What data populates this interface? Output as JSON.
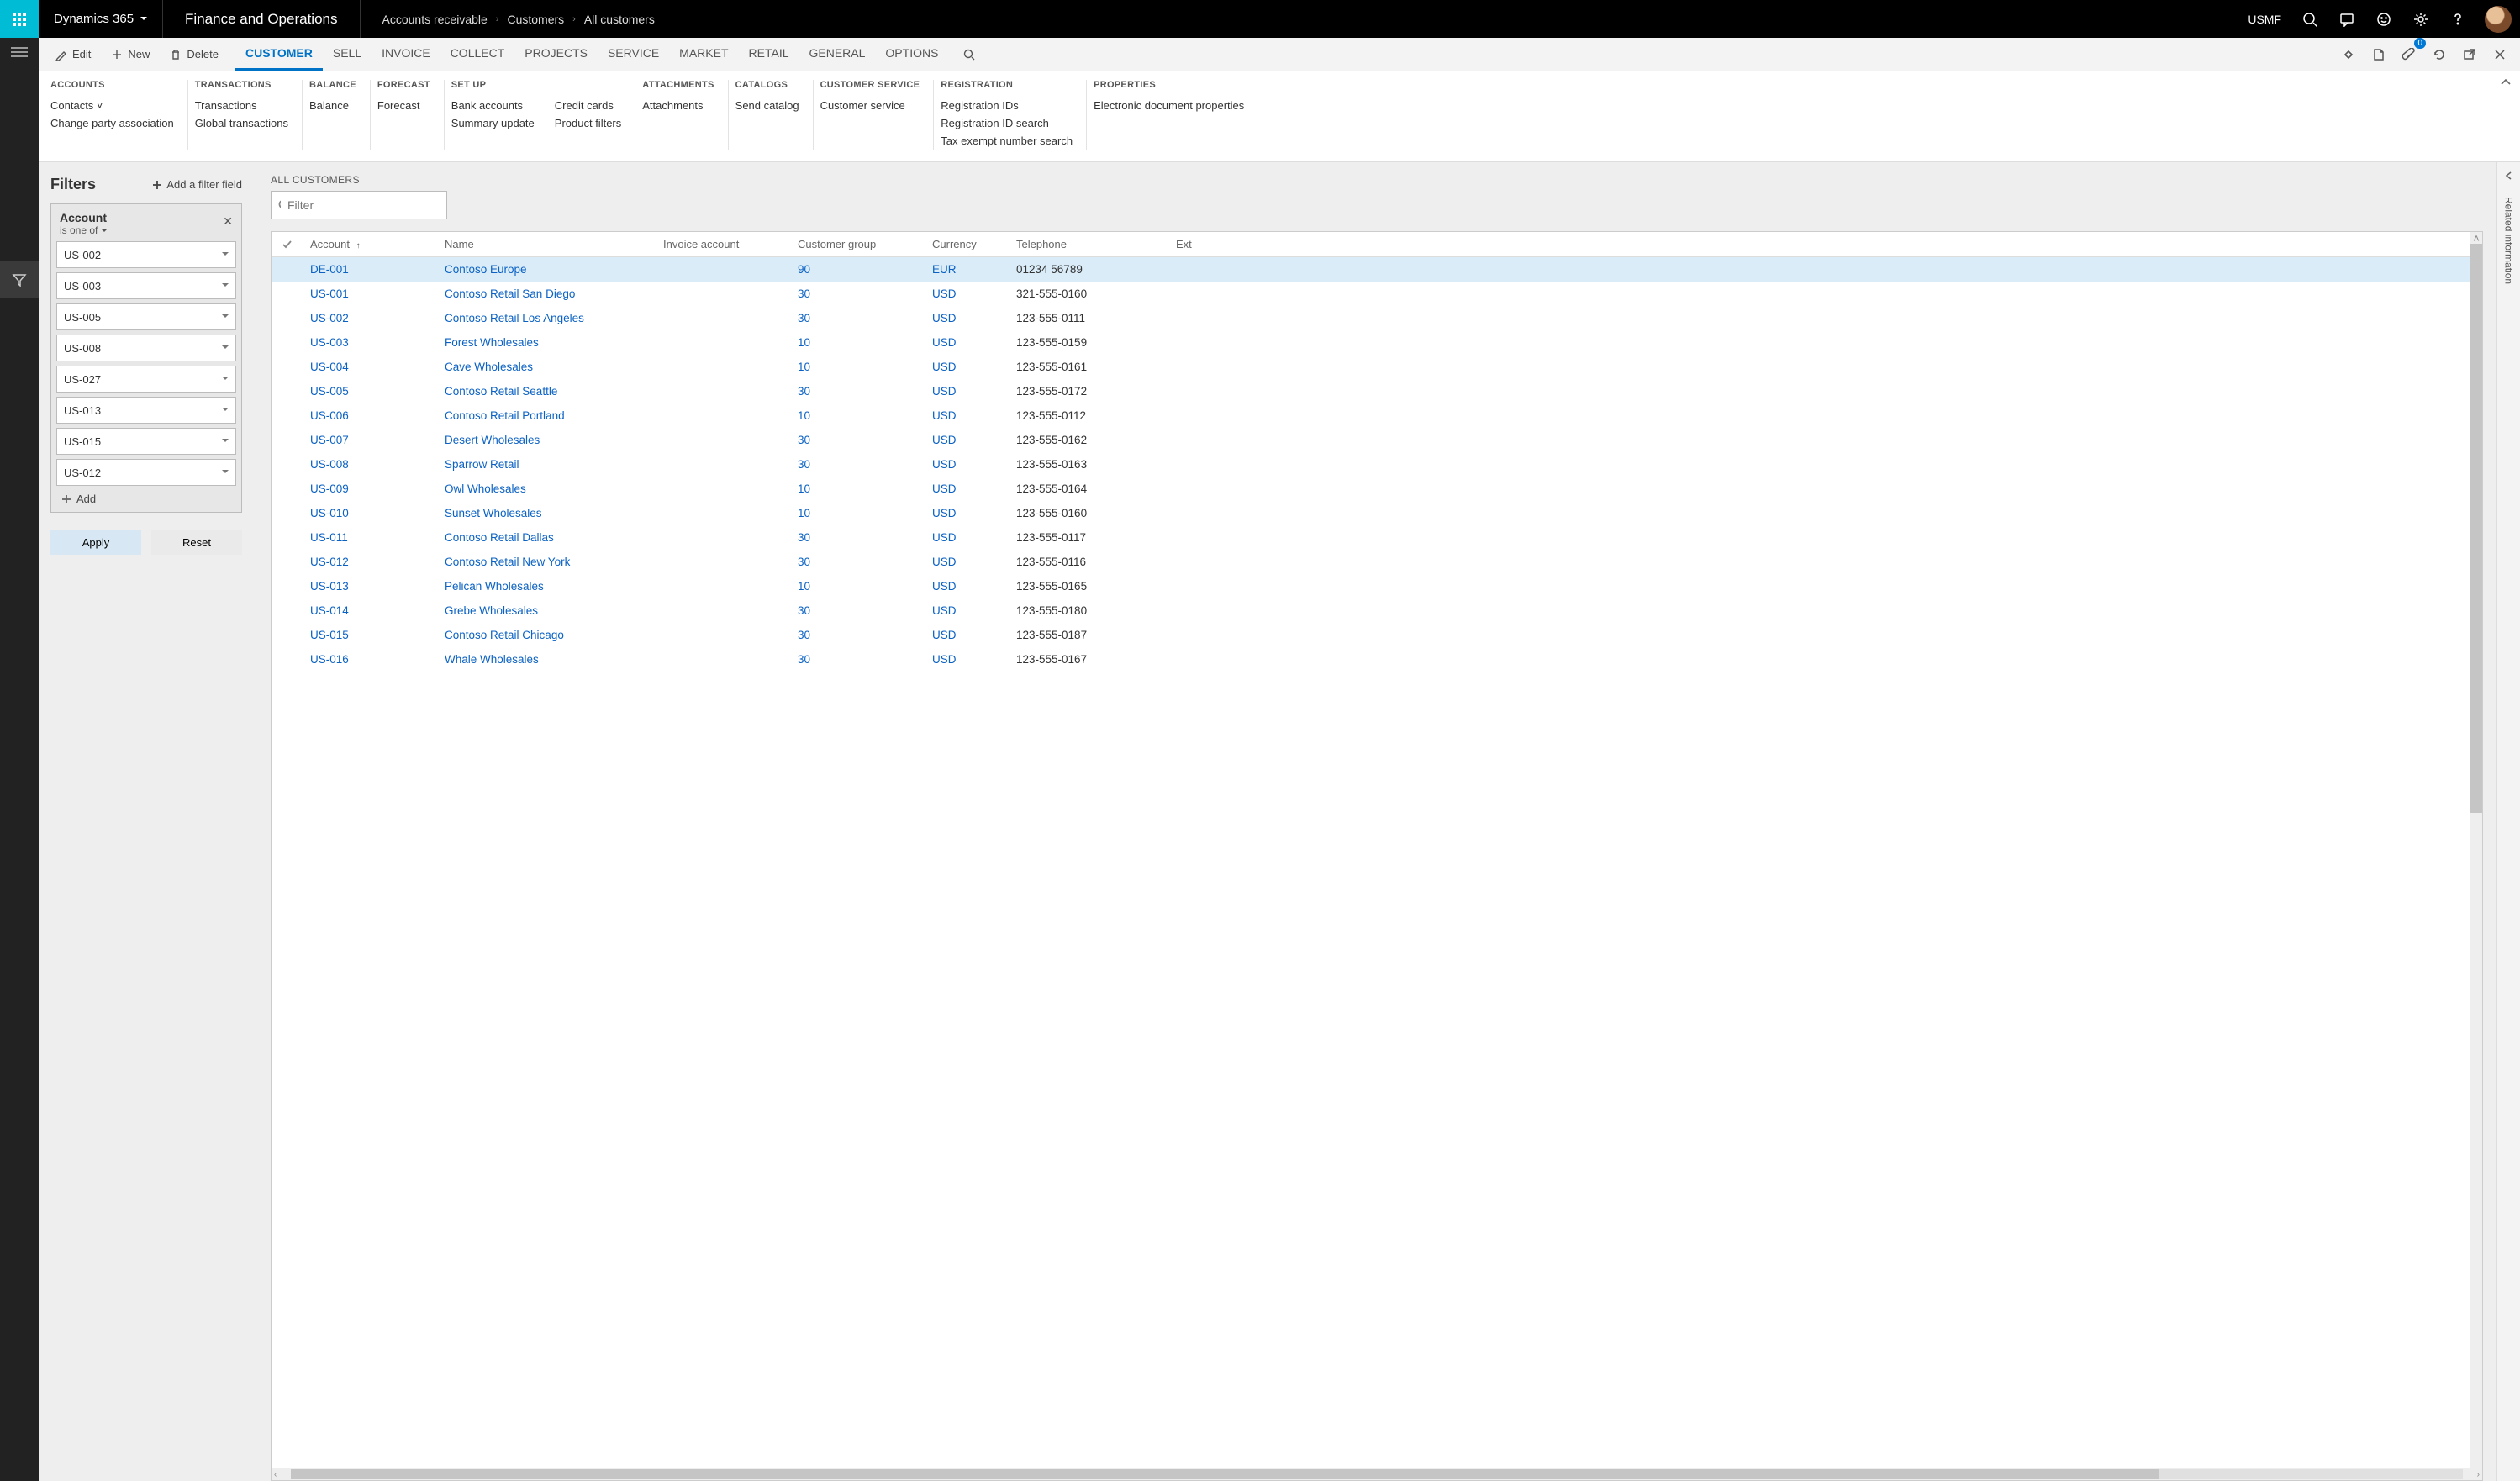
{
  "topbar": {
    "app_name": "Dynamics 365",
    "product": "Finance and Operations",
    "breadcrumb": [
      "Accounts receivable",
      "Customers",
      "All customers"
    ],
    "legal_entity": "USMF"
  },
  "actionbar": {
    "edit": "Edit",
    "new": "New",
    "delete": "Delete",
    "tabs": [
      "CUSTOMER",
      "SELL",
      "INVOICE",
      "COLLECT",
      "PROJECTS",
      "SERVICE",
      "MARKET",
      "RETAIL",
      "GENERAL",
      "OPTIONS"
    ],
    "active_tab": "CUSTOMER",
    "attach_count": "0"
  },
  "ribbon": {
    "groups": [
      {
        "title": "ACCOUNTS",
        "cols": [
          [
            "Contacts ˅",
            "Change party association"
          ]
        ]
      },
      {
        "title": "TRANSACTIONS",
        "cols": [
          [
            "Transactions",
            "Global transactions"
          ]
        ]
      },
      {
        "title": "BALANCE",
        "cols": [
          [
            "Balance"
          ]
        ]
      },
      {
        "title": "FORECAST",
        "cols": [
          [
            "Forecast"
          ]
        ]
      },
      {
        "title": "SET UP",
        "cols": [
          [
            "Bank accounts",
            "Summary update"
          ],
          [
            "Credit cards",
            "Product filters"
          ]
        ]
      },
      {
        "title": "ATTACHMENTS",
        "cols": [
          [
            "Attachments"
          ]
        ]
      },
      {
        "title": "CATALOGS",
        "cols": [
          [
            "Send catalog"
          ]
        ]
      },
      {
        "title": "CUSTOMER SERVICE",
        "cols": [
          [
            "Customer service"
          ]
        ]
      },
      {
        "title": "REGISTRATION",
        "cols": [
          [
            "Registration IDs",
            "Registration ID search",
            "Tax exempt number search"
          ]
        ]
      },
      {
        "title": "PROPERTIES",
        "cols": [
          [
            "Electronic document properties"
          ]
        ]
      }
    ]
  },
  "filters": {
    "title": "Filters",
    "add_field_label": "Add a filter field",
    "field_name": "Account",
    "operator": "is one of",
    "values": [
      "US-002",
      "US-003",
      "US-005",
      "US-008",
      "US-027",
      "US-013",
      "US-015",
      "US-012"
    ],
    "add_label": "Add",
    "apply": "Apply",
    "reset": "Reset"
  },
  "list": {
    "title": "ALL CUSTOMERS",
    "filter_placeholder": "Filter",
    "columns": [
      "Account",
      "Name",
      "Invoice account",
      "Customer group",
      "Currency",
      "Telephone",
      "Ext"
    ],
    "sort_col": "Account",
    "rows": [
      {
        "account": "DE-001",
        "name": "Contoso Europe",
        "inv": "",
        "grp": "90",
        "cur": "EUR",
        "tel": "01234 56789",
        "selected": true
      },
      {
        "account": "US-001",
        "name": "Contoso Retail San Diego",
        "inv": "",
        "grp": "30",
        "cur": "USD",
        "tel": "321-555-0160"
      },
      {
        "account": "US-002",
        "name": "Contoso Retail Los Angeles",
        "inv": "",
        "grp": "30",
        "cur": "USD",
        "tel": "123-555-0111"
      },
      {
        "account": "US-003",
        "name": "Forest Wholesales",
        "inv": "",
        "grp": "10",
        "cur": "USD",
        "tel": "123-555-0159"
      },
      {
        "account": "US-004",
        "name": "Cave Wholesales",
        "inv": "",
        "grp": "10",
        "cur": "USD",
        "tel": "123-555-0161"
      },
      {
        "account": "US-005",
        "name": "Contoso Retail Seattle",
        "inv": "",
        "grp": "30",
        "cur": "USD",
        "tel": "123-555-0172"
      },
      {
        "account": "US-006",
        "name": "Contoso Retail Portland",
        "inv": "",
        "grp": "10",
        "cur": "USD",
        "tel": "123-555-0112"
      },
      {
        "account": "US-007",
        "name": "Desert Wholesales",
        "inv": "",
        "grp": "30",
        "cur": "USD",
        "tel": "123-555-0162"
      },
      {
        "account": "US-008",
        "name": "Sparrow Retail",
        "inv": "",
        "grp": "30",
        "cur": "USD",
        "tel": "123-555-0163"
      },
      {
        "account": "US-009",
        "name": "Owl Wholesales",
        "inv": "",
        "grp": "10",
        "cur": "USD",
        "tel": "123-555-0164"
      },
      {
        "account": "US-010",
        "name": "Sunset Wholesales",
        "inv": "",
        "grp": "10",
        "cur": "USD",
        "tel": "123-555-0160"
      },
      {
        "account": "US-011",
        "name": "Contoso Retail Dallas",
        "inv": "",
        "grp": "30",
        "cur": "USD",
        "tel": "123-555-0117"
      },
      {
        "account": "US-012",
        "name": "Contoso Retail New York",
        "inv": "",
        "grp": "30",
        "cur": "USD",
        "tel": "123-555-0116"
      },
      {
        "account": "US-013",
        "name": "Pelican Wholesales",
        "inv": "",
        "grp": "10",
        "cur": "USD",
        "tel": "123-555-0165"
      },
      {
        "account": "US-014",
        "name": "Grebe Wholesales",
        "inv": "",
        "grp": "30",
        "cur": "USD",
        "tel": "123-555-0180"
      },
      {
        "account": "US-015",
        "name": "Contoso Retail Chicago",
        "inv": "",
        "grp": "30",
        "cur": "USD",
        "tel": "123-555-0187"
      },
      {
        "account": "US-016",
        "name": "Whale Wholesales",
        "inv": "",
        "grp": "30",
        "cur": "USD",
        "tel": "123-555-0167"
      }
    ]
  },
  "related_info_label": "Related information"
}
